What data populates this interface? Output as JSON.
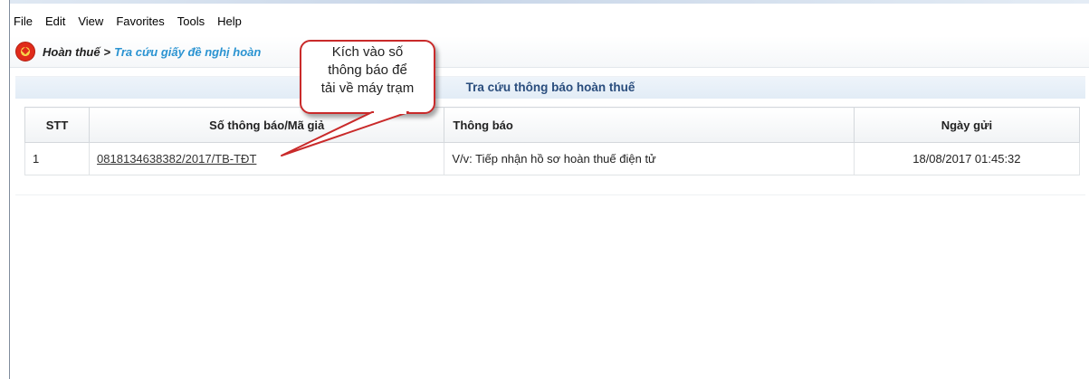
{
  "menu": {
    "items": [
      "File",
      "Edit",
      "View",
      "Favorites",
      "Tools",
      "Help"
    ]
  },
  "breadcrumb": {
    "root": "Hoàn thuế",
    "separator": ">",
    "current": "Tra cứu giấy đề nghị hoàn"
  },
  "panel": {
    "title": "Tra cứu thông báo hoàn thuế"
  },
  "table": {
    "headers": {
      "stt": "STT",
      "so_thong_bao": "Số thông báo/Mã giả",
      "thong_bao": "Thông báo",
      "ngay_gui": "Ngày gửi"
    },
    "rows": [
      {
        "stt": "1",
        "so_thong_bao": "0818134638382/2017/TB-TĐT",
        "thong_bao": "V/v: Tiếp nhận hồ sơ hoàn thuế điện tử",
        "ngay_gui": "18/08/2017 01:45:32"
      }
    ]
  },
  "callout": {
    "lines": [
      "Kích vào số",
      "thông báo để",
      "tải về máy trạm"
    ]
  },
  "colors": {
    "callout_border": "#c92a2a",
    "panel_title": "#2a4d7d",
    "breadcrumb_current": "#2a93d1"
  },
  "icons": {
    "breadcrumb": "national-emblem-icon"
  }
}
